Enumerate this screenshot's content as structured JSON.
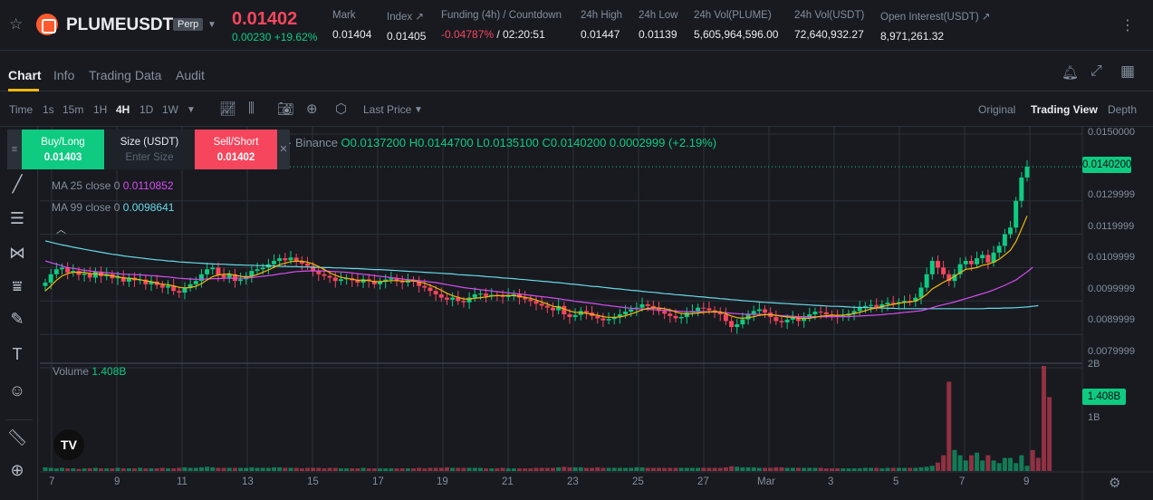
{
  "ticker": {
    "symbol": "PLUMEUSDT",
    "contract_type": "Perp",
    "last_price": "0.01402",
    "change": "0.00230 +19.62%",
    "stats": [
      {
        "label": "Mark",
        "value": "0.01404"
      },
      {
        "label": "Index ↗",
        "value": "0.01405"
      },
      {
        "label": "Funding (4h) / Countdown",
        "value_red": "-0.04787%",
        "value": " / 02:20:51"
      },
      {
        "label": "24h High",
        "value": "0.01447"
      },
      {
        "label": "24h Low",
        "value": "0.01139"
      },
      {
        "label": "24h Vol(PLUME)",
        "value": "5,605,964,596.00"
      },
      {
        "label": "24h Vol(USDT)",
        "value": "72,640,932.27"
      },
      {
        "label": "Open Interest(USDT) ↗",
        "value": "8,971,261.32"
      }
    ]
  },
  "tabs": [
    "Chart",
    "Info",
    "Trading Data",
    "Audit"
  ],
  "toolbar": {
    "time_label": "Time",
    "intervals": [
      "1s",
      "15m",
      "1H",
      "4H",
      "1D",
      "1W"
    ],
    "active_interval": "4H",
    "price_type": "Last Price",
    "views": [
      "Original",
      "Trading View",
      "Depth"
    ],
    "active_view": "Trading View"
  },
  "order_panel": {
    "buy_label": "Buy/Long",
    "buy_price": "0.01403",
    "size_label": "Size (USDT)",
    "size_placeholder": "Enter Size",
    "sell_label": "Sell/Short",
    "sell_price": "0.01402"
  },
  "legend": {
    "exchange": "· Binance",
    "ohlc": "O0.0137200 H0.0144700 L0.0135100 C0.0140200 0.0002999 (+2.19%)",
    "ma25_label": "MA 25 close 0",
    "ma25_value": "0.0110852",
    "ma99_label": "MA 99 close 0",
    "ma99_value": "0.0098641",
    "volume_label": "Volume",
    "volume_value": "1.408B"
  },
  "colors": {
    "up": "#0ecb81",
    "down": "#f6465d",
    "ma7": "#f0b90b",
    "ma25": "#d64ef0",
    "ma99": "#68d8e6",
    "accent": "#f0b90b"
  },
  "chart_data": {
    "type": "candlestick",
    "interval": "4H",
    "y_axis_ticks": [
      "0.0150000",
      "0.0129999",
      "0.0119999",
      "0.0109999",
      "0.0099999",
      "0.0089999",
      "0.0079999"
    ],
    "last_price_tag": "0.0140200",
    "volume_axis_ticks": [
      "2B",
      "1B"
    ],
    "volume_tag": "1.408B",
    "x_axis_ticks": [
      "7",
      "9",
      "11",
      "13",
      "15",
      "17",
      "19",
      "21",
      "23",
      "25",
      "27",
      "Mar",
      "3",
      "5",
      "7",
      "9"
    ],
    "close_series": [
      0.01055,
      0.0108,
      0.01095,
      0.011,
      0.01085,
      0.0109,
      0.01078,
      0.01082,
      0.0107,
      0.01088,
      0.01074,
      0.0108,
      0.01068,
      0.01072,
      0.01058,
      0.0107,
      0.01062,
      0.01064,
      0.0105,
      0.01058,
      0.01048,
      0.0104,
      0.01046,
      0.0103,
      0.01025,
      0.0104,
      0.0105,
      0.0106,
      0.0108,
      0.01095,
      0.011,
      0.01078,
      0.0107,
      0.0108,
      0.0106,
      0.01065,
      0.01075,
      0.0109,
      0.01095,
      0.011,
      0.0111,
      0.0112,
      0.01128,
      0.01122,
      0.0113,
      0.01118,
      0.01112,
      0.01105,
      0.0109,
      0.0108,
      0.01075,
      0.0107,
      0.0106,
      0.01065,
      0.01068,
      0.01062,
      0.01055,
      0.01065,
      0.0106,
      0.0105,
      0.01058,
      0.01064,
      0.01068,
      0.0106,
      0.01055,
      0.01062,
      0.01058,
      0.01045,
      0.0104,
      0.0103,
      0.0102,
      0.0101,
      0.01004,
      0.0101,
      0.01,
      0.00996,
      0.0101,
      0.0102,
      0.01022,
      0.01015,
      0.01018,
      0.01016,
      0.01012,
      0.01018,
      0.0102,
      0.0101,
      0.01005,
      0.01,
      0.00992,
      0.00986,
      0.0098,
      0.00972,
      0.00985,
      0.0096,
      0.00952,
      0.00958,
      0.0097,
      0.00965,
      0.00955,
      0.00948,
      0.00942,
      0.00946,
      0.00952,
      0.0096,
      0.00968,
      0.00975,
      0.0098,
      0.0099,
      0.00985,
      0.00978,
      0.0097,
      0.00962,
      0.00955,
      0.00948,
      0.00952,
      0.00965,
      0.0097,
      0.0098,
      0.00978,
      0.00972,
      0.00965,
      0.0096,
      0.0094,
      0.00922,
      0.0093,
      0.00945,
      0.0096,
      0.0097,
      0.00975,
      0.00965,
      0.00952,
      0.0094,
      0.00936,
      0.00944,
      0.0095,
      0.0094,
      0.0095,
      0.0096,
      0.00968,
      0.00966,
      0.0096,
      0.00958,
      0.00952,
      0.00956,
      0.00962,
      0.0097,
      0.0098,
      0.00985,
      0.00988,
      0.00982,
      0.0099,
      0.00995,
      0.00992,
      0.00996,
      0.01,
      0.00998,
      0.0101,
      0.0104,
      0.0108,
      0.0112,
      0.011,
      0.0108,
      0.0106,
      0.0108,
      0.0111,
      0.0112,
      0.0111,
      0.01128,
      0.01138,
      0.01115,
      0.01145,
      0.01165,
      0.012,
      0.0122,
      0.013,
      0.0137,
      0.01402
    ],
    "ma7_series": [
      0.0103,
      0.01045,
      0.01062,
      0.01075,
      0.01082,
      0.01086,
      0.01086,
      0.01086,
      0.01082,
      0.01081,
      0.0108,
      0.01078,
      0.01075,
      0.01073,
      0.01069,
      0.01068,
      0.01066,
      0.01064,
      0.0106,
      0.01058,
      0.01054,
      0.0105,
      0.01049,
      0.01045,
      0.01041,
      0.01039,
      0.0104,
      0.01044,
      0.01052,
      0.01063,
      0.01073,
      0.01078,
      0.0108,
      0.01081,
      0.01077,
      0.01074,
      0.01072,
      0.01074,
      0.01079,
      0.01086,
      0.01093,
      0.01101,
      0.01109,
      0.01113,
      0.01118,
      0.01119,
      0.01119,
      0.01116,
      0.01111,
      0.01103,
      0.01094,
      0.01085,
      0.01077,
      0.01071,
      0.01068,
      0.01065,
      0.01062,
      0.01062,
      0.01061,
      0.01058,
      0.01058,
      0.01059,
      0.01061,
      0.01061,
      0.0106,
      0.0106,
      0.0106,
      0.01057,
      0.01053,
      0.01047,
      0.0104,
      0.01032,
      0.01023,
      0.01016,
      0.01011,
      0.01006,
      0.01006,
      0.01008,
      0.0101,
      0.01012,
      0.01015,
      0.01016,
      0.01016,
      0.01016,
      0.01016,
      0.01014,
      0.01011,
      0.01008,
      0.01003,
      0.00997,
      0.00991,
      0.00984,
      0.00982,
      0.00976,
      0.0097,
      0.00966,
      0.00965,
      0.00963,
      0.0096,
      0.00957,
      0.00953,
      0.00951,
      0.00951,
      0.00952,
      0.00956,
      0.00961,
      0.00967,
      0.00974,
      0.00978,
      0.00979,
      0.00979,
      0.00977,
      0.00973,
      0.00967,
      0.00963,
      0.00961,
      0.00962,
      0.00964,
      0.00966,
      0.00967,
      0.00968,
      0.00967,
      0.00962,
      0.00955,
      0.0095,
      0.00948,
      0.0095,
      0.00953,
      0.00957,
      0.00959,
      0.00959,
      0.00957,
      0.00954,
      0.00952,
      0.00951,
      0.00949,
      0.00948,
      0.00948,
      0.00951,
      0.00954,
      0.00956,
      0.00957,
      0.00957,
      0.00958,
      0.00959,
      0.00962,
      0.00966,
      0.00971,
      0.00976,
      0.00979,
      0.00983,
      0.00987,
      0.0099,
      0.00993,
      0.00996,
      0.00997,
      0.01,
      0.01008,
      0.0102,
      0.01036,
      0.01046,
      0.01056,
      0.01064,
      0.01074,
      0.01085,
      0.01095,
      0.01097,
      0.011,
      0.01107,
      0.0111,
      0.01116,
      0.01125,
      0.01138,
      0.01152,
      0.01178,
      0.01215,
      0.01255
    ],
    "ma25_series": [
      0.0112,
      0.01115,
      0.0111,
      0.01105,
      0.011,
      0.01098,
      0.01095,
      0.01092,
      0.0109,
      0.01088,
      0.01086,
      0.01085,
      0.01083,
      0.01082,
      0.0108,
      0.0108,
      0.01079,
      0.01078,
      0.01077,
      0.01076,
      0.01075,
      0.01073,
      0.01072,
      0.0107,
      0.01068,
      0.01067,
      0.01066,
      0.01065,
      0.01065,
      0.01066,
      0.01067,
      0.01067,
      0.01068,
      0.01068,
      0.01068,
      0.01068,
      0.01069,
      0.0107,
      0.01072,
      0.01074,
      0.01076,
      0.01078,
      0.01081,
      0.01083,
      0.01086,
      0.01088,
      0.01089,
      0.0109,
      0.0109,
      0.0109,
      0.0109,
      0.01089,
      0.01088,
      0.01087,
      0.01086,
      0.01084,
      0.01082,
      0.0108,
      0.01078,
      0.01076,
      0.01074,
      0.01072,
      0.0107,
      0.01068,
      0.01066,
      0.01064,
      0.01063,
      0.01061,
      0.01059,
      0.01057,
      0.01055,
      0.01052,
      0.01049,
      0.01046,
      0.01043,
      0.0104,
      0.01038,
      0.01036,
      0.01034,
      0.01032,
      0.0103,
      0.01028,
      0.01026,
      0.01024,
      0.01023,
      0.01021,
      0.01019,
      0.01017,
      0.01015,
      0.01013,
      0.01011,
      0.01009,
      0.01007,
      0.01004,
      0.01002,
      0.00999,
      0.00997,
      0.00995,
      0.00993,
      0.00991,
      0.00988,
      0.00986,
      0.00984,
      0.00982,
      0.0098,
      0.00978,
      0.00977,
      0.00976,
      0.00975,
      0.00974,
      0.00973,
      0.00972,
      0.00971,
      0.0097,
      0.00969,
      0.00968,
      0.00968,
      0.00968,
      0.00968,
      0.00967,
      0.00967,
      0.00966,
      0.00965,
      0.00963,
      0.00962,
      0.00961,
      0.0096,
      0.0096,
      0.0096,
      0.00959,
      0.00958,
      0.00957,
      0.00956,
      0.00955,
      0.00954,
      0.00953,
      0.00953,
      0.00953,
      0.00953,
      0.00953,
      0.00953,
      0.00953,
      0.00953,
      0.00953,
      0.00953,
      0.00954,
      0.00955,
      0.00956,
      0.00957,
      0.00958,
      0.00959,
      0.00961,
      0.00962,
      0.00964,
      0.00966,
      0.00967,
      0.00969,
      0.00971,
      0.00975,
      0.0098,
      0.00985,
      0.00989,
      0.00993,
      0.00997,
      0.01002,
      0.01007,
      0.01012,
      0.01017,
      0.01022,
      0.01027,
      0.01033,
      0.0104,
      0.01047,
      0.01055,
      0.01063,
      0.01075,
      0.01087,
      0.01101
    ],
    "ma99_series": [
      0.0118,
      0.01176,
      0.01172,
      0.01168,
      0.01165,
      0.01161,
      0.01158,
      0.01155,
      0.01152,
      0.01149,
      0.01146,
      0.01143,
      0.0114,
      0.01138,
      0.01135,
      0.01133,
      0.01131,
      0.01129,
      0.01127,
      0.01125,
      0.01123,
      0.01122,
      0.0112,
      0.01119,
      0.01117,
      0.01116,
      0.01115,
      0.01114,
      0.01113,
      0.01112,
      0.01111,
      0.0111,
      0.0111,
      0.01109,
      0.01108,
      0.01108,
      0.01107,
      0.01107,
      0.01106,
      0.01106,
      0.01105,
      0.01105,
      0.01104,
      0.01104,
      0.01103,
      0.01103,
      0.01102,
      0.01102,
      0.01101,
      0.01101,
      0.011,
      0.011,
      0.01099,
      0.01099,
      0.01098,
      0.01097,
      0.01097,
      0.01096,
      0.01095,
      0.01094,
      0.01094,
      0.01093,
      0.01092,
      0.01091,
      0.0109,
      0.01089,
      0.01088,
      0.01087,
      0.01086,
      0.01085,
      0.01084,
      0.01083,
      0.01082,
      0.01081,
      0.01079,
      0.01078,
      0.01077,
      0.01076,
      0.01075,
      0.01073,
      0.01072,
      0.01071,
      0.01069,
      0.01068,
      0.01067,
      0.01065,
      0.01064,
      0.01062,
      0.01061,
      0.01059,
      0.01058,
      0.01056,
      0.01055,
      0.01053,
      0.01051,
      0.0105,
      0.01048,
      0.01046,
      0.01044,
      0.01043,
      0.01041,
      0.01039,
      0.01037,
      0.01036,
      0.01034,
      0.01032,
      0.01031,
      0.01029,
      0.01027,
      0.01026,
      0.01024,
      0.01022,
      0.01021,
      0.01019,
      0.01018,
      0.01016,
      0.01015,
      0.01013,
      0.01012,
      0.0101,
      0.01009,
      0.01007,
      0.01006,
      0.01004,
      0.01003,
      0.01001,
      0.01,
      0.00999,
      0.00997,
      0.00996,
      0.00995,
      0.00994,
      0.00993,
      0.00992,
      0.00991,
      0.0099,
      0.00989,
      0.00988,
      0.00987,
      0.00986,
      0.00985,
      0.00984,
      0.00984,
      0.00983,
      0.00982,
      0.00981,
      0.00981,
      0.0098,
      0.0098,
      0.00979,
      0.00979,
      0.00978,
      0.00978,
      0.00977,
      0.00977,
      0.00977,
      0.00977,
      0.00977,
      0.00977,
      0.00977,
      0.00977,
      0.00977,
      0.00977,
      0.00977,
      0.00977,
      0.00977,
      0.00977,
      0.00977,
      0.00977,
      0.00978,
      0.00978,
      0.00978,
      0.00979,
      0.00979,
      0.0098,
      0.00981,
      0.00982,
      0.00984,
      0.00986
    ],
    "volume_series_billion": [
      0.07,
      0.06,
      0.05,
      0.06,
      0.05,
      0.05,
      0.04,
      0.05,
      0.05,
      0.06,
      0.05,
      0.05,
      0.05,
      0.06,
      0.05,
      0.05,
      0.05,
      0.06,
      0.05,
      0.05,
      0.05,
      0.06,
      0.05,
      0.05,
      0.06,
      0.07,
      0.06,
      0.06,
      0.07,
      0.08,
      0.07,
      0.06,
      0.06,
      0.06,
      0.06,
      0.06,
      0.06,
      0.07,
      0.06,
      0.06,
      0.06,
      0.07,
      0.07,
      0.06,
      0.06,
      0.06,
      0.05,
      0.06,
      0.06,
      0.06,
      0.05,
      0.06,
      0.06,
      0.05,
      0.05,
      0.05,
      0.05,
      0.06,
      0.05,
      0.05,
      0.05,
      0.05,
      0.05,
      0.05,
      0.05,
      0.05,
      0.05,
      0.06,
      0.05,
      0.06,
      0.06,
      0.06,
      0.07,
      0.06,
      0.06,
      0.06,
      0.06,
      0.06,
      0.06,
      0.05,
      0.05,
      0.05,
      0.06,
      0.05,
      0.05,
      0.05,
      0.05,
      0.05,
      0.06,
      0.06,
      0.06,
      0.06,
      0.07,
      0.08,
      0.07,
      0.07,
      0.07,
      0.06,
      0.06,
      0.07,
      0.06,
      0.06,
      0.06,
      0.06,
      0.06,
      0.06,
      0.07,
      0.07,
      0.06,
      0.06,
      0.06,
      0.06,
      0.06,
      0.06,
      0.06,
      0.06,
      0.06,
      0.06,
      0.06,
      0.06,
      0.06,
      0.06,
      0.07,
      0.09,
      0.08,
      0.07,
      0.07,
      0.07,
      0.06,
      0.06,
      0.06,
      0.07,
      0.07,
      0.06,
      0.06,
      0.06,
      0.06,
      0.06,
      0.06,
      0.06,
      0.05,
      0.05,
      0.05,
      0.05,
      0.05,
      0.05,
      0.05,
      0.06,
      0.06,
      0.06,
      0.05,
      0.06,
      0.06,
      0.06,
      0.06,
      0.06,
      0.06,
      0.07,
      0.08,
      0.1,
      0.16,
      0.3,
      1.7,
      0.4,
      0.3,
      0.2,
      0.3,
      0.35,
      0.2,
      0.3,
      0.2,
      0.15,
      0.25,
      0.25,
      0.15,
      0.3,
      0.1,
      0.4,
      0.25,
      2.0,
      1.408
    ],
    "ylim": [
      0.0079999,
      0.015
    ]
  }
}
